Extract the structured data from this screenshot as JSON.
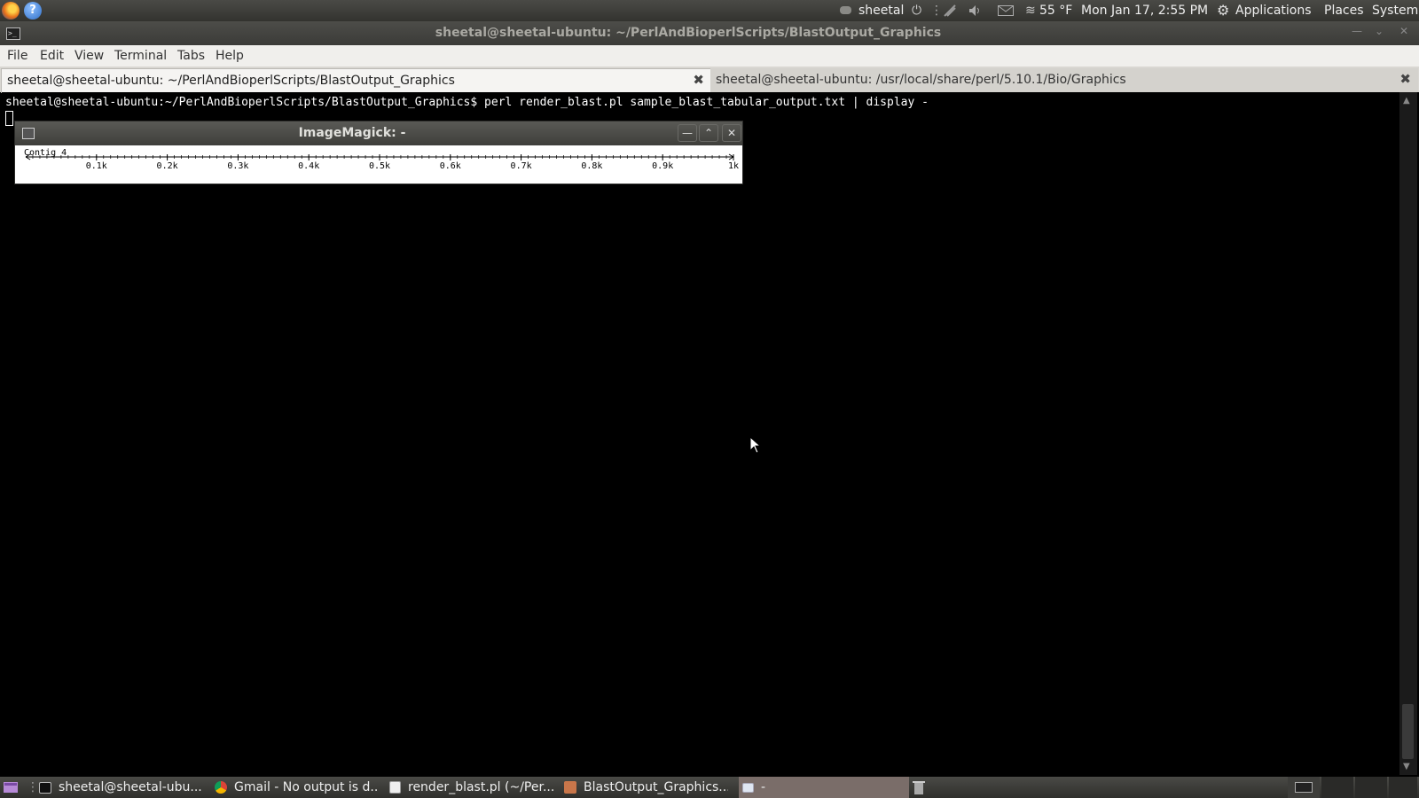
{
  "top_panel": {
    "user": "sheetal",
    "weather": "55 °F",
    "datetime": "Mon Jan 17,  2:55 PM",
    "menus": [
      "Applications",
      "Places",
      "System"
    ]
  },
  "window": {
    "title": "sheetal@sheetal-ubuntu: ~/PerlAndBioperlScripts/BlastOutput_Graphics"
  },
  "menubar": [
    "File",
    "Edit",
    "View",
    "Terminal",
    "Tabs",
    "Help"
  ],
  "tabs": [
    {
      "label": "sheetal@sheetal-ubuntu: ~/PerlAndBioperlScripts/BlastOutput_Graphics",
      "close": "✖"
    },
    {
      "label": "sheetal@sheetal-ubuntu: /usr/local/share/perl/5.10.1/Bio/Graphics",
      "close": "✖"
    }
  ],
  "terminal": {
    "prompt": "sheetal@sheetal-ubuntu:~/PerlAndBioperlScripts/BlastOutput_Graphics$ ",
    "command": "perl render_blast.pl sample_blast_tabular_output.txt | display -"
  },
  "imagemagick": {
    "title": "ImageMagick: -",
    "track_label": "Contig_4",
    "ruler": {
      "min": 0,
      "max": 1000,
      "major_ticks": [
        100,
        200,
        300,
        400,
        500,
        600,
        700,
        800,
        900,
        1000
      ],
      "labels": [
        "0.1k",
        "0.2k",
        "0.3k",
        "0.4k",
        "0.5k",
        "0.6k",
        "0.7k",
        "0.8k",
        "0.9k",
        "1k"
      ],
      "minor_step": 10
    }
  },
  "taskbar": [
    {
      "label": "sheetal@sheetal-ubu...",
      "icon": "terminal-icon"
    },
    {
      "label": "Gmail - No output is d...",
      "icon": "chrome-icon"
    },
    {
      "label": "render_blast.pl (~/Per...",
      "icon": "text-editor-icon"
    },
    {
      "label": "BlastOutput_Graphics...",
      "icon": "folder-icon"
    },
    {
      "label": "-",
      "icon": "window-icon"
    }
  ]
}
